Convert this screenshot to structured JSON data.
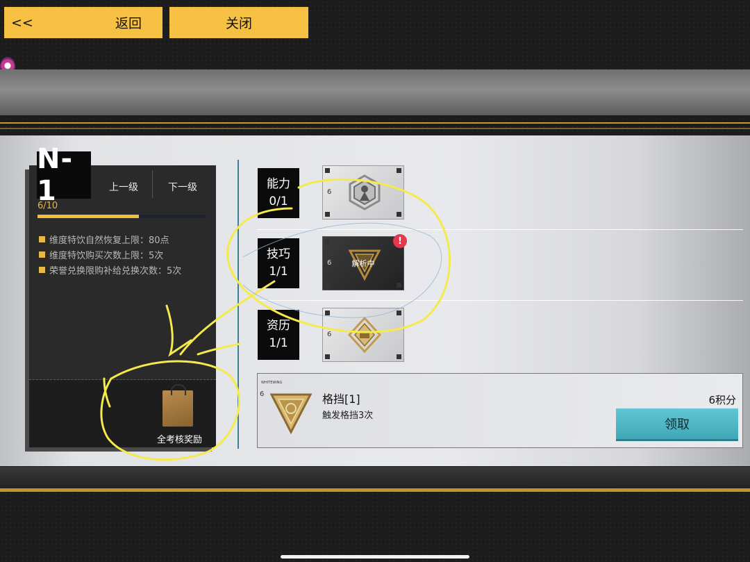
{
  "topbar": {
    "back_prefix": "<<",
    "back_label": "返回",
    "close_label": "关闭"
  },
  "level_panel": {
    "level": "N-1",
    "prev_label": "上一级",
    "next_label": "下一级",
    "progress_text": "6/10",
    "progress_fraction": 0.6,
    "bonuses": [
      "维度特饮自然恢复上限：80点",
      "维度特饮购买次数上限：5次",
      "荣誉兑换限购补给兑换次数：5次"
    ],
    "full_reward_label": "全考核奖励"
  },
  "categories": [
    {
      "name": "能力",
      "count": "0/1",
      "card_level": "6",
      "card_status": ""
    },
    {
      "name": "技巧",
      "count": "1/1",
      "card_level": "6",
      "card_status": "解析中"
    },
    {
      "name": "资历",
      "count": "1/1",
      "card_level": "6",
      "card_status": ""
    }
  ],
  "alert_badge": "!",
  "reward": {
    "brand": "WHITEWING",
    "level": "6",
    "name": "格挡[1]",
    "description": "触发格挡3次",
    "points": "6积分",
    "claim_label": "领取"
  },
  "colors": {
    "accent_gold": "#f6c143",
    "claim_teal": "#4fb7c5",
    "alert_red": "#e4384d",
    "annotation_yellow": "#f4ea4c"
  }
}
